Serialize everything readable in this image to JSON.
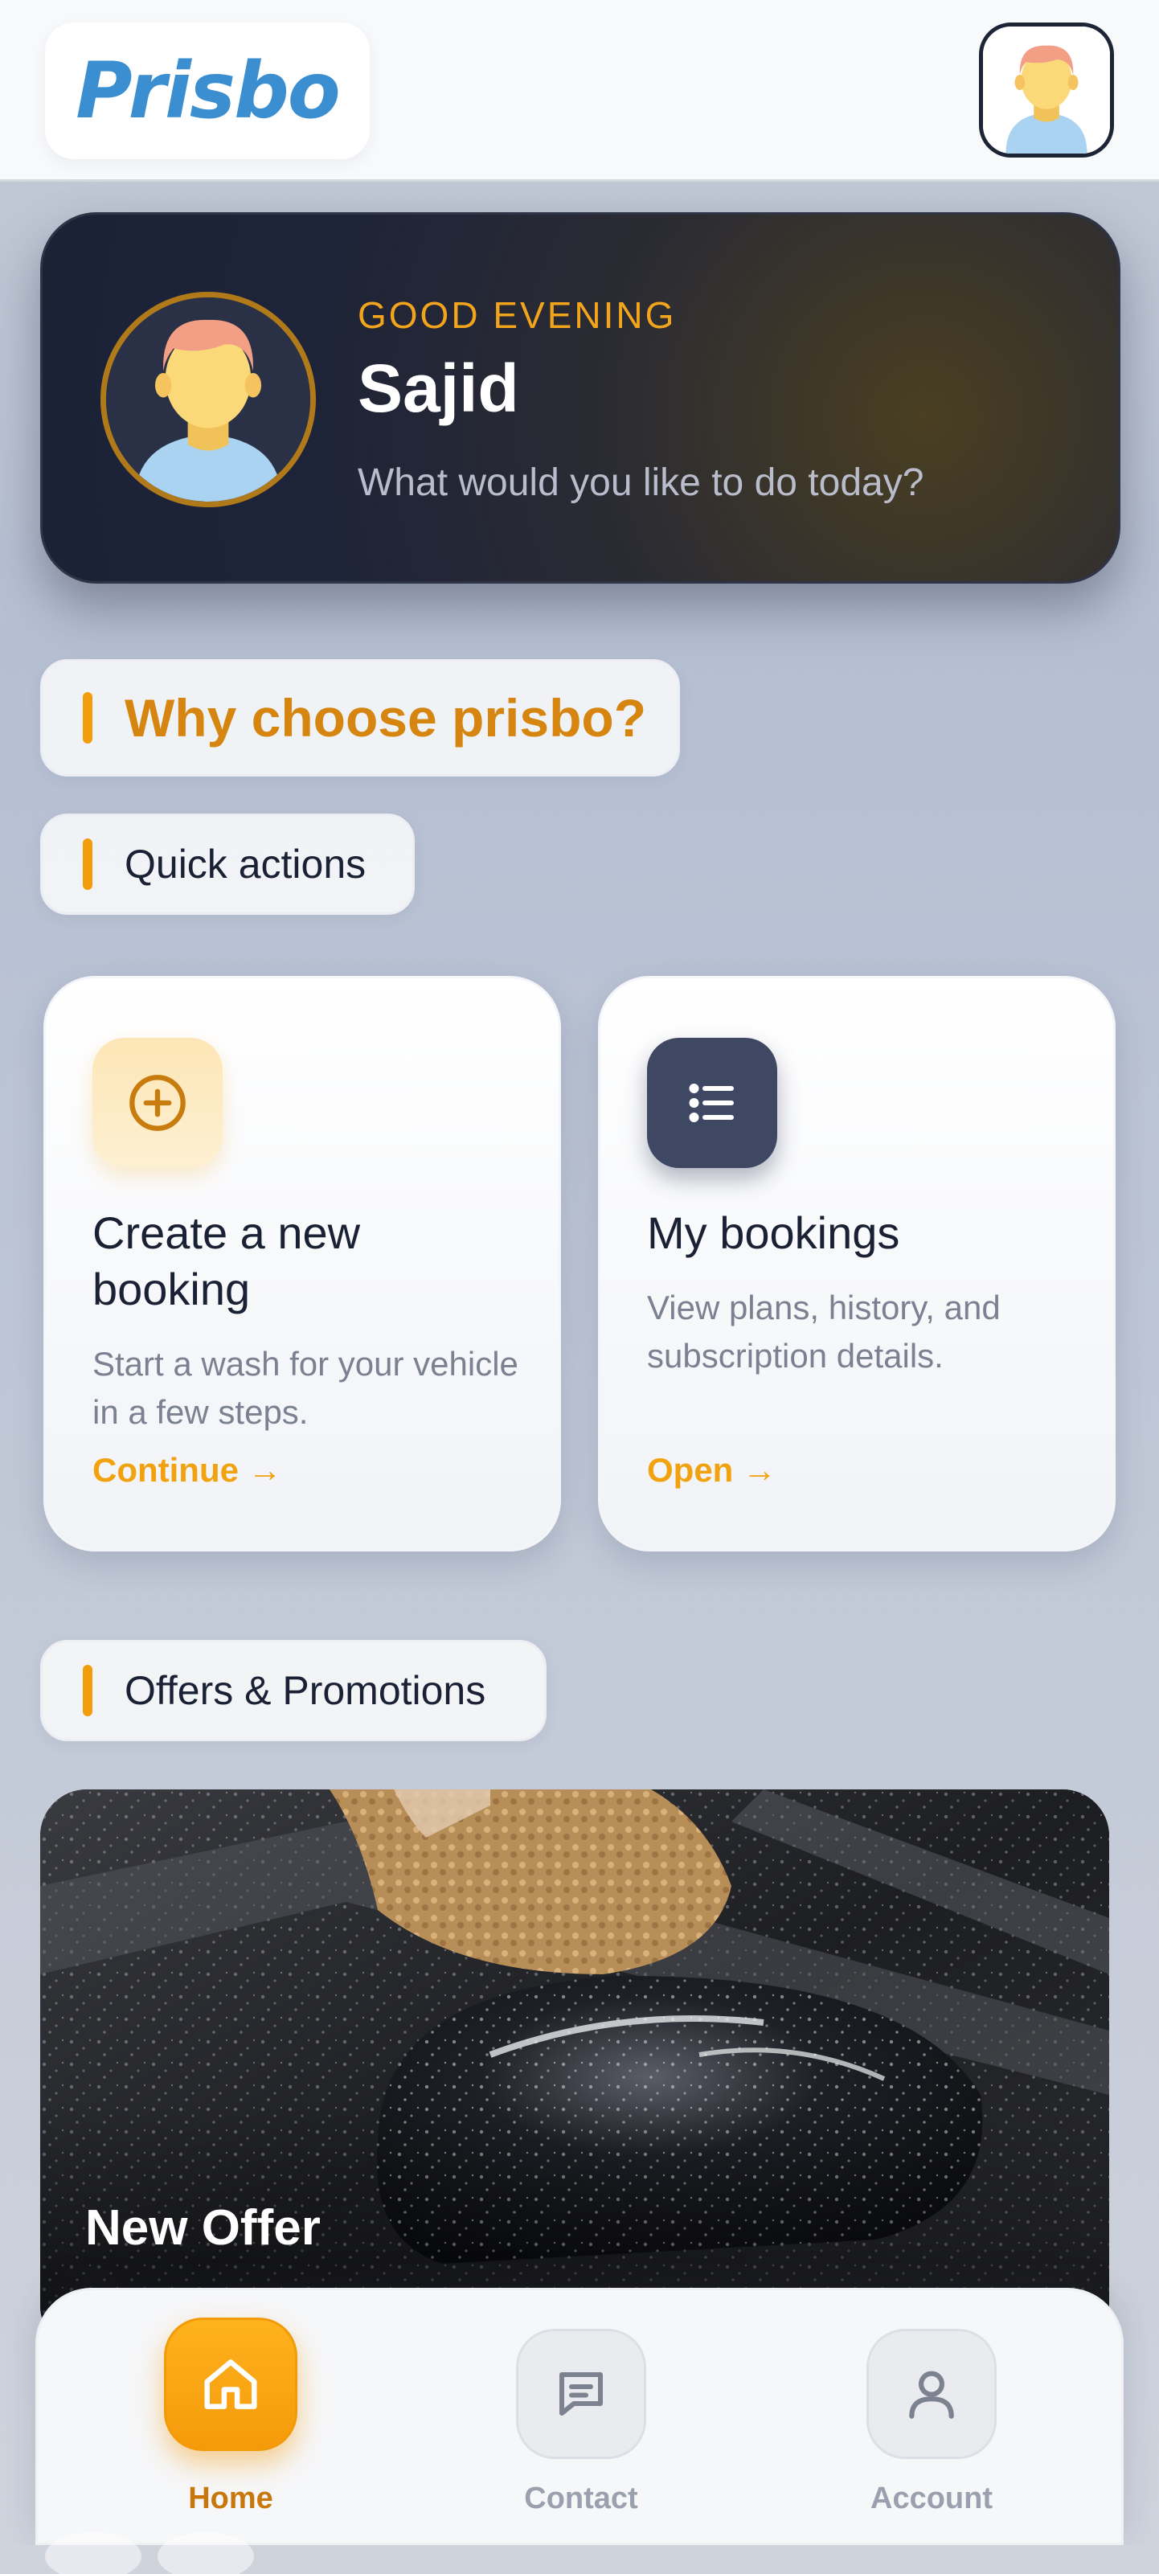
{
  "header": {
    "logo": "Prisbo",
    "avatar_icon": "user-avatar-icon"
  },
  "greeting": {
    "salutation": "GOOD EVENING",
    "name": "Sajid",
    "subtitle": "What would you like to do today?"
  },
  "sections": {
    "why": "Why choose prisbo?",
    "quick": "Quick actions",
    "offers": "Offers & Promotions"
  },
  "cards": [
    {
      "title": "Create a new booking",
      "description": "Start a wash for your vehicle in a few steps.",
      "link": "Continue →",
      "icon": "plus-circle-icon"
    },
    {
      "title": "My bookings",
      "description": "View plans, history, and subscription details.",
      "link": "Open →",
      "icon": "list-icon"
    }
  ],
  "offer": {
    "title": "New Offer"
  },
  "nav": {
    "items": [
      {
        "label": "Home",
        "icon": "home-icon",
        "active": true
      },
      {
        "label": "Contact",
        "icon": "message-icon",
        "active": false
      },
      {
        "label": "Account",
        "icon": "user-icon",
        "active": false
      }
    ]
  },
  "colors": {
    "accent": "#f29e0c",
    "dark": "#1d2338",
    "logo": "#3b8fd0"
  }
}
